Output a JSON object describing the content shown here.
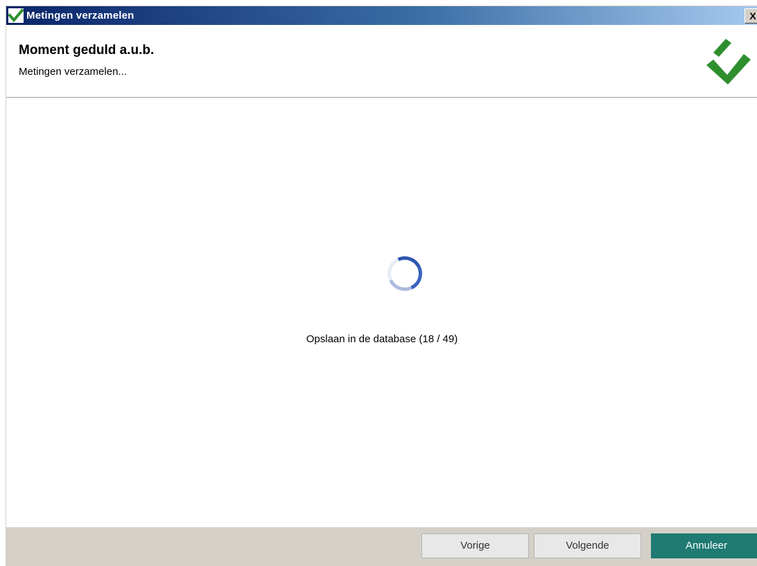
{
  "window": {
    "title": "Metingen verzamelen",
    "close_label": "X"
  },
  "header": {
    "title": "Moment geduld a.u.b.",
    "subtitle": "Metingen verzamelen..."
  },
  "content": {
    "status": "Opslaan in de database (18 / 49)",
    "progress": {
      "current": 18,
      "total": 49
    }
  },
  "footer": {
    "prev_label": "Vorige",
    "next_label": "Volgende",
    "cancel_label": "Annuleer"
  },
  "colors": {
    "brand_green": "#2f8f2f",
    "accent_teal": "#1e7a72",
    "titlebar_start": "#0a246a",
    "titlebar_end": "#a6caf0"
  },
  "icons": {
    "app": "checkmark-icon",
    "logo": "checkmark-icon",
    "loading": "spinner-icon"
  }
}
